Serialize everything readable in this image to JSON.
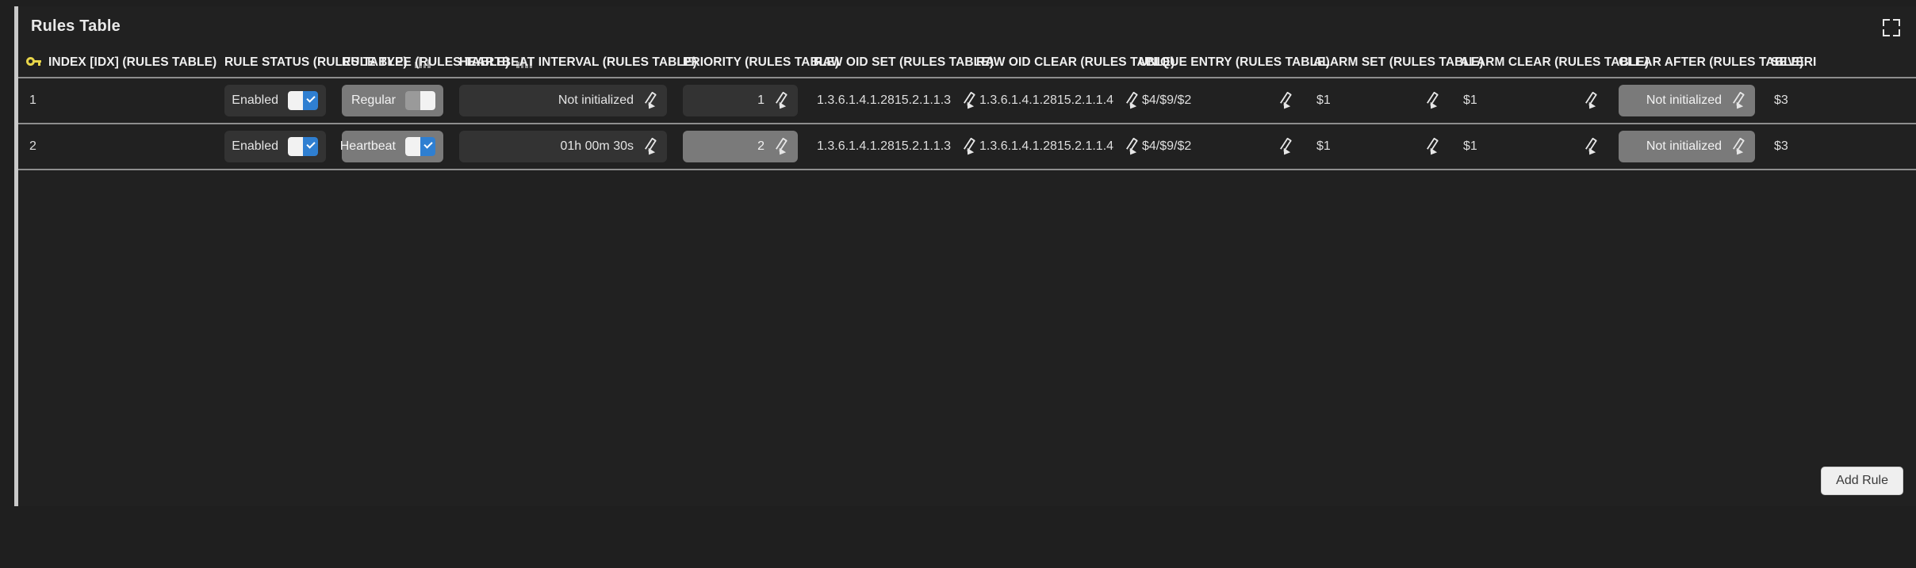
{
  "panel": {
    "title": "Rules Table",
    "expand_icon": "expand-fullscreen-icon"
  },
  "table": {
    "columns": [
      {
        "label": "INDEX [IDX] (RULES TABLE)",
        "icon": "key-icon",
        "align": "left"
      },
      {
        "label": "RULE STATUS (RULES TABLE)",
        "icon": "bars-icon",
        "align": "right"
      },
      {
        "label": "RULE TYPE (RULES TABLE)",
        "icon": "bars-icon",
        "align": "right"
      },
      {
        "label": "HEARTBEAT INTERVAL (RULES TABLE)",
        "icon": "",
        "align": "right"
      },
      {
        "label": "PRIORITY (RULES TABLE)",
        "icon": "",
        "align": "right"
      },
      {
        "label": "RAW OID SET (RULES TABLE)",
        "icon": "",
        "align": "left"
      },
      {
        "label": "RAW OID CLEAR (RULES TABLE)",
        "icon": "",
        "align": "left"
      },
      {
        "label": "UNIQUE ENTRY (RULES TABLE)",
        "icon": "",
        "align": "left"
      },
      {
        "label": "ALARM SET (RULES TABLE)",
        "icon": "",
        "align": "left"
      },
      {
        "label": "ALARM CLEAR (RULES TABLE)",
        "icon": "",
        "align": "left"
      },
      {
        "label": "CLEAR AFTER (RULES TABLE)",
        "icon": "",
        "align": "right"
      },
      {
        "label": "SEVERI",
        "icon": "",
        "align": "left"
      }
    ],
    "rows": [
      {
        "index": "1",
        "rule_status": {
          "label": "Enabled",
          "toggle": "on",
          "highlighted": false
        },
        "rule_type": {
          "label": "Regular",
          "toggle": "off",
          "highlighted": true
        },
        "heartbeat_interval": {
          "label": "Not initialized",
          "highlighted": false
        },
        "priority": {
          "label": "1",
          "highlighted": false
        },
        "raw_oid_set": "1.3.6.1.4.1.2815.2.1.1.3",
        "raw_oid_clear": "1.3.6.1.4.1.2815.2.1.1.4",
        "unique_entry": "$4/$9/$2",
        "alarm_set": "$1",
        "alarm_clear": "$1",
        "clear_after": {
          "label": "Not initialized",
          "highlighted": true
        },
        "severity": "$3"
      },
      {
        "index": "2",
        "rule_status": {
          "label": "Enabled",
          "toggle": "on",
          "highlighted": false
        },
        "rule_type": {
          "label": "Heartbeat",
          "toggle": "on",
          "highlighted": true
        },
        "heartbeat_interval": {
          "label": "01h 00m 30s",
          "highlighted": false
        },
        "priority": {
          "label": "2",
          "highlighted": true
        },
        "raw_oid_set": "1.3.6.1.4.1.2815.2.1.1.3",
        "raw_oid_clear": "1.3.6.1.4.1.2815.2.1.1.4",
        "unique_entry": "$4/$9/$2",
        "alarm_set": "$1",
        "alarm_clear": "$1",
        "clear_after": {
          "label": "Not initialized",
          "highlighted": true
        },
        "severity": "$3"
      }
    ]
  },
  "footer": {
    "add_rule_label": "Add Rule"
  },
  "colors": {
    "panel_bg": "#212121",
    "page_bg": "#1f1f1f",
    "accent_bar": "#c9c9c9",
    "chip_bg": "#333333",
    "chip_highlight": "#7a7a7a",
    "toggle_on": "#2f7fd1",
    "toggle_off": "#9a9a9a",
    "key_icon": "#e8d54a",
    "row_divider": "#8e8e8e"
  }
}
